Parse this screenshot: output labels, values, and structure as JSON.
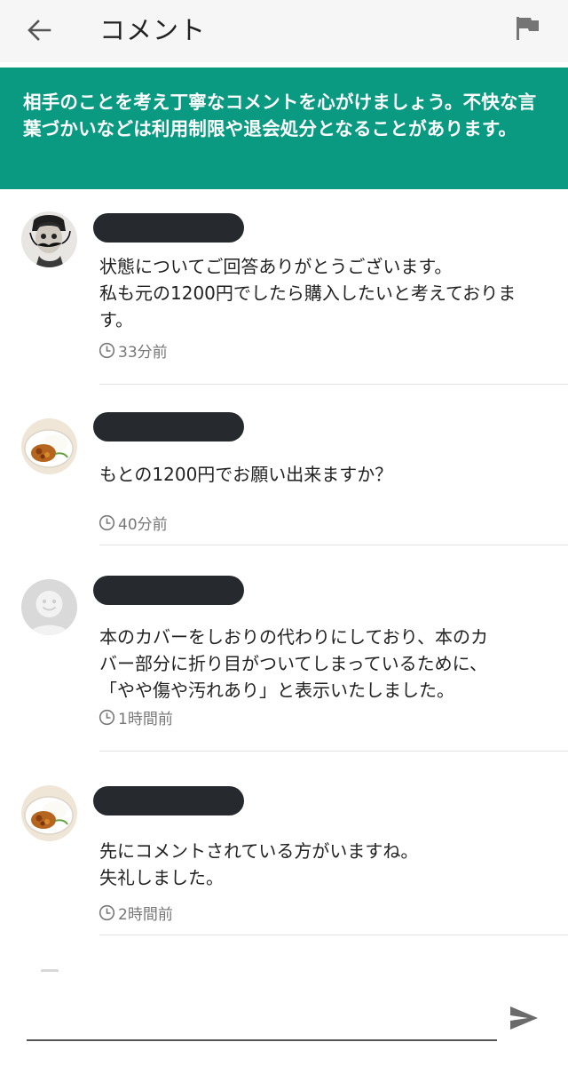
{
  "header": {
    "title": "コメント",
    "back_icon": "arrow-left-icon",
    "report_icon": "flag-icon"
  },
  "notice": {
    "text": "相手のことを考え丁寧なコメントを心がけましょう。不快な言葉づかいなどは利用制限や退会処分となることがあります。",
    "background_color": "#0a9a82"
  },
  "comments": [
    {
      "avatar": "mustache-portrait-avatar",
      "username": "",
      "text": "状態についてご回答ありがとうございます。\n私も元の1200円でしたら購入したいと考えておりま\nす。",
      "time": "33分前"
    },
    {
      "avatar": "curry-rice-avatar",
      "username": "",
      "text": "もとの1200円でお願い出来ますか？",
      "time": "40分前"
    },
    {
      "avatar": "default-smiley-avatar",
      "username": "",
      "text": "本のカバーをしおりの代わりにしており、本のカ\nバー部分に折り目がついてしまっているために、\n「やや傷や汚れあり」と表示いたしました。",
      "time": "1時間前"
    },
    {
      "avatar": "curry-rice-avatar",
      "username": "",
      "text": "先にコメントされている方がいますね。\n失礼しました。",
      "time": "2時間前"
    }
  ],
  "input": {
    "value": "",
    "placeholder": "",
    "send_icon": "send-icon"
  },
  "colors": {
    "accent": "#0a9a82",
    "redaction": "#262a2e",
    "meta_text": "#777777"
  }
}
